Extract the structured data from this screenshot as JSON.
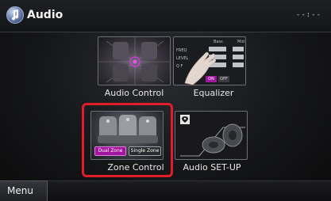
{
  "header": {
    "title": "Audio",
    "icon": "audio-note-icon",
    "clock": "--:--"
  },
  "tiles": [
    {
      "id": "audio_control",
      "label": "Audio Control"
    },
    {
      "id": "equalizer",
      "label": "Equalizer"
    },
    {
      "id": "zone_control",
      "label": "Zone Control",
      "selected": true
    },
    {
      "id": "audio_setup",
      "label": "Audio SET-UP"
    }
  ],
  "zone_control": {
    "dual_zone": "Dual Zone",
    "single_zone": "Single Zone"
  },
  "equalizer_thumb": {
    "col_bass": "Bass",
    "col_mid": "Mid",
    "row_freq": "FREQ",
    "row_level": "LEVEL",
    "row_q": "Q F",
    "on": "ON",
    "off": "OFF"
  },
  "footer": {
    "menu_label": "Menu"
  },
  "colors": {
    "highlight": "#e21d2a",
    "accent": "#a0159b"
  }
}
